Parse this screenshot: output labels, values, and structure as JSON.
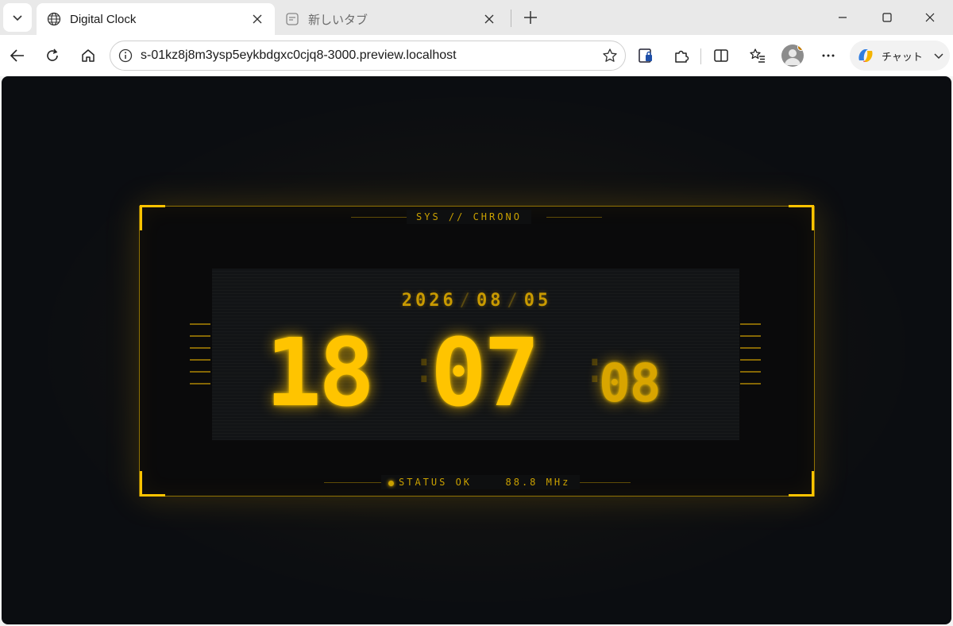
{
  "browser": {
    "tabs": [
      {
        "title": "Digital Clock",
        "active": true,
        "icon": "globe-icon"
      },
      {
        "title": "新しいタブ",
        "active": false,
        "icon": "new-tab-page-icon"
      }
    ],
    "url": "s-01kz8j8m3ysp5eykbdgxc0cjq8-3000.preview.localhost",
    "chat_label": "チャット"
  },
  "clock": {
    "header_label": "SYS // CHRONO",
    "date": {
      "year": "2026",
      "month": "08",
      "day": "05",
      "separator": "/"
    },
    "time": {
      "hours": "18",
      "minutes": "07",
      "seconds": "08",
      "separator": ":"
    },
    "status_label": "STATUS OK",
    "frequency_label": "88.8 MHz"
  },
  "colors": {
    "accent": "#ffc400",
    "background": "#0b0d11"
  }
}
